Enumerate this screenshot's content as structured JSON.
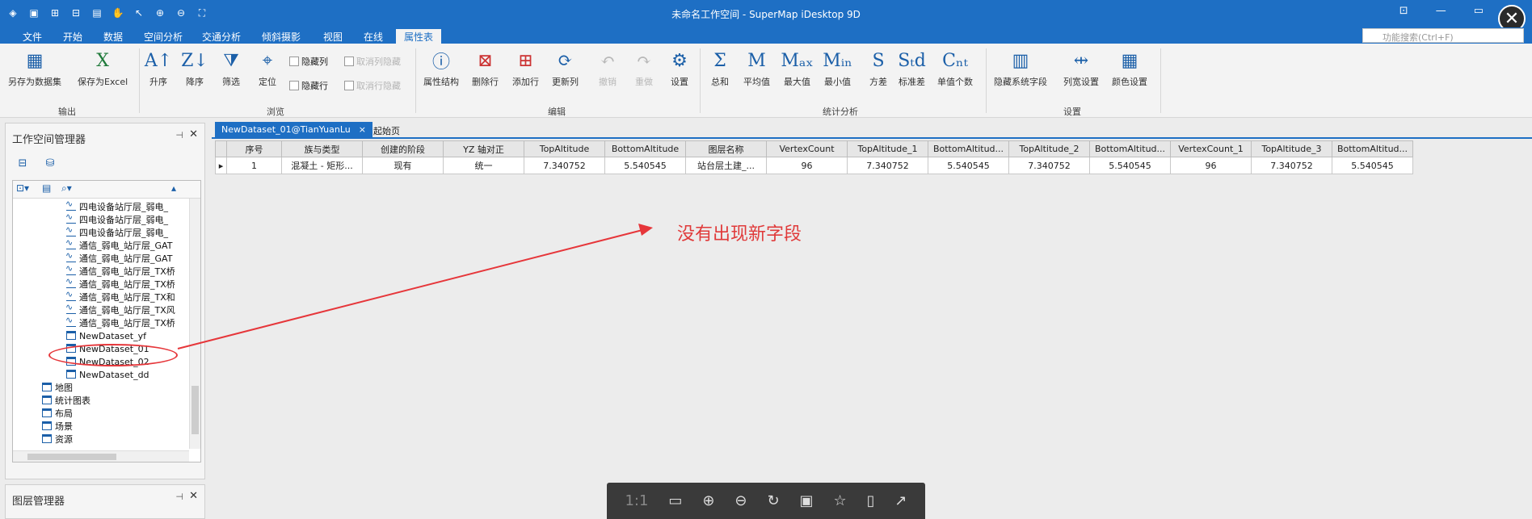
{
  "window": {
    "title": "未命名工作空间 - SuperMap iDesktop 9D",
    "quick_access_icons": [
      "app-logo-icon",
      "save-icon",
      "open-icon",
      "close-file-icon",
      "paste-icon",
      "pan-icon",
      "select-icon",
      "zoom-in-icon",
      "zoom-out-icon",
      "fullextent-icon"
    ],
    "close_glyph": "✕"
  },
  "menu": {
    "tabs": [
      "文件",
      "开始",
      "数据",
      "空间分析",
      "交通分析",
      "倾斜摄影",
      "视图",
      "在线",
      "属性表"
    ],
    "active": "属性表",
    "search_placeholder": "功能搜索(Ctrl+F)"
  },
  "ribbon": {
    "output": {
      "group": "输出",
      "save_dataset": "另存为数据集",
      "save_excel": "保存为Excel"
    },
    "browse": {
      "group": "浏览",
      "asc": "升序",
      "desc": "降序",
      "filter": "筛选",
      "locate": "定位",
      "hide_col": "隐藏列",
      "hide_row": "隐藏行",
      "unhide_col": "取消列隐藏",
      "unhide_row": "取消行隐藏"
    },
    "edit": {
      "group": "编辑",
      "attr_struct": "属性结构",
      "del_row": "删除行",
      "add_row": "添加行",
      "update_col": "更新列",
      "undo": "撤销",
      "redo": "重做",
      "settings": "设置"
    },
    "stats": {
      "group": "统计分析",
      "sum": "总和",
      "avg": "平均值",
      "max": "最大值",
      "min": "最小值",
      "variance": "方差",
      "std": "标准差",
      "unique": "单值个数",
      "sum_glyph": "Σ",
      "avg_glyph": "M",
      "max_glyph": "Mₐₓ",
      "min_glyph": "Mᵢₙ",
      "var_glyph": "S",
      "std_glyph": "Sₜd",
      "unique_glyph": "Cₙₜ"
    },
    "settings": {
      "group": "设置",
      "hide_sys": "隐藏系统字段",
      "col_width": "列宽设置",
      "color": "颜色设置"
    }
  },
  "workspace": {
    "title": "工作空间管理器",
    "pin": "⊣",
    "close": "✕",
    "nodes": [
      {
        "label": "四电设备站厅层_弱电_",
        "icon": "line"
      },
      {
        "label": "四电设备站厅层_弱电_",
        "icon": "line"
      },
      {
        "label": "四电设备站厅层_弱电_",
        "icon": "line"
      },
      {
        "label": "通信_弱电_站厅层_GAT",
        "icon": "line"
      },
      {
        "label": "通信_弱电_站厅层_GAT",
        "icon": "line"
      },
      {
        "label": "通信_弱电_站厅层_TX桥",
        "icon": "line"
      },
      {
        "label": "通信_弱电_站厅层_TX桥",
        "icon": "line"
      },
      {
        "label": "通信_弱电_站厅层_TX和",
        "icon": "line"
      },
      {
        "label": "通信_弱电_站厅层_TX风",
        "icon": "line"
      },
      {
        "label": "通信_弱电_站厅层_TX桥",
        "icon": "line"
      },
      {
        "label": "NewDataset_yf",
        "icon": "tbl"
      },
      {
        "label": "NewDataset_01",
        "icon": "tbl"
      },
      {
        "label": "NewDataset_02",
        "icon": "tbl"
      },
      {
        "label": "NewDataset_dd",
        "icon": "tbl"
      }
    ],
    "roots": [
      "地图",
      "统计图表",
      "布局",
      "场景",
      "资源"
    ]
  },
  "layers": {
    "title": "图层管理器"
  },
  "doc": {
    "tabs": [
      "NewDataset_01@TianYuanLu",
      "起始页"
    ],
    "columns": [
      "序号",
      "族与类型",
      "创建的阶段",
      "YZ 轴对正",
      "TopAltitude",
      "BottomAltitude",
      "图层名称",
      "VertexCount",
      "TopAltitude_1",
      "BottomAltitud...",
      "TopAltitude_2",
      "BottomAltitud...",
      "VertexCount_1",
      "TopAltitude_3",
      "BottomAltitud..."
    ],
    "row": [
      "1",
      "混凝土 - 矩形...",
      "现有",
      "统一",
      "7.340752",
      "5.540545",
      "站台层土建_...",
      "96",
      "7.340752",
      "5.540545",
      "7.340752",
      "5.540545",
      "96",
      "7.340752",
      "5.540545"
    ],
    "row_marker": "▸"
  },
  "annotation": {
    "text": "没有出现新字段",
    "color": "#e6363a"
  },
  "viewer": {
    "ratio": "1:1"
  },
  "colors": {
    "brand": "#1e6fc4",
    "annotation": "#e6363a"
  }
}
